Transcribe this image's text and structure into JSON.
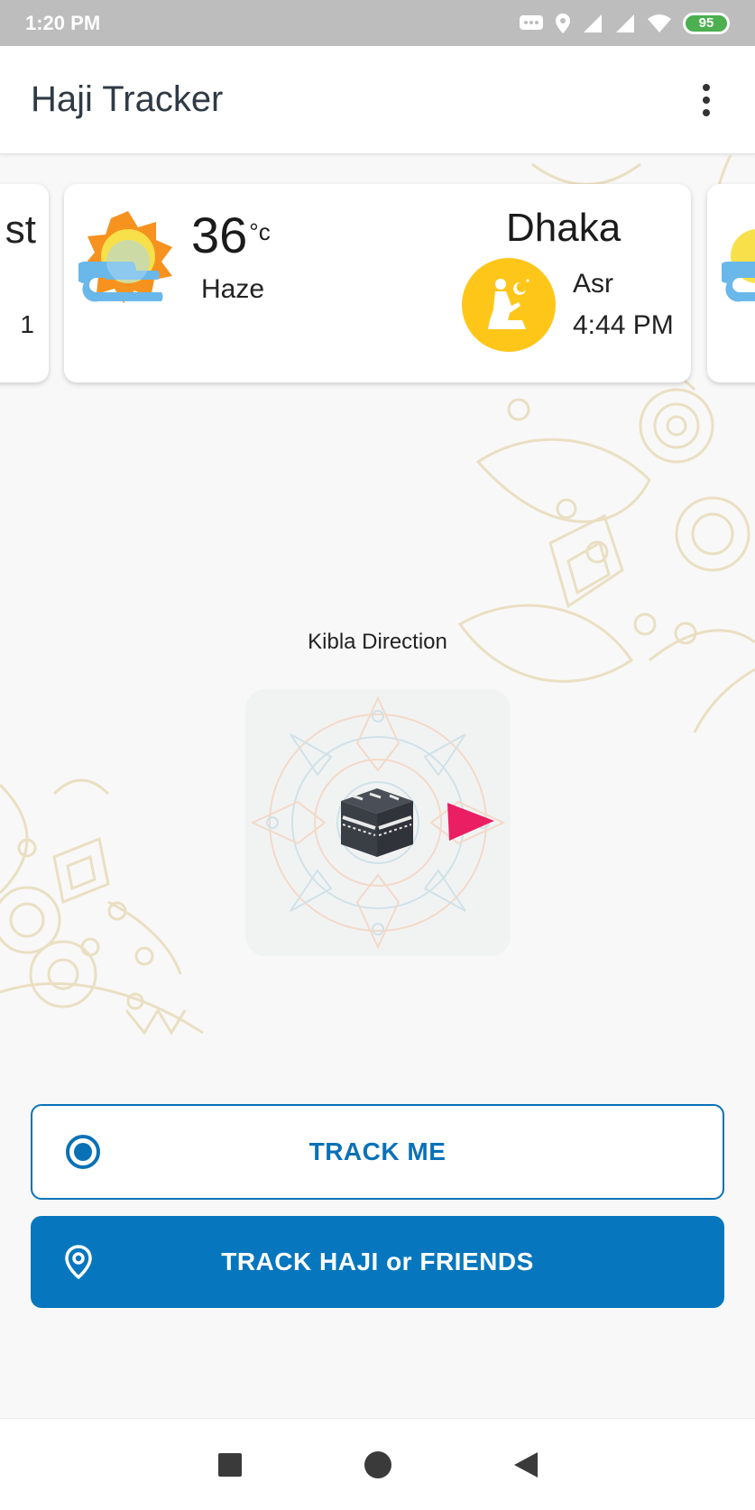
{
  "status_bar": {
    "time": "1:20 PM",
    "battery": "95"
  },
  "app_bar": {
    "title": "Haji Tracker"
  },
  "cards": {
    "left_fragment": {
      "top_text": "st",
      "bottom_text": "1"
    },
    "main": {
      "temperature": "36",
      "temperature_unit": "°c",
      "condition": "Haze",
      "city": "Dhaka",
      "prayer_name": "Asr",
      "prayer_time": "4:44 PM"
    }
  },
  "kibla": {
    "label": "Kibla Direction"
  },
  "buttons": {
    "track_me": "TRACK ME",
    "track_friends": "TRACK HAJI or FRIENDS"
  },
  "icons": {
    "weather": "haze-sun-icon",
    "prayer": "prayer-person-icon",
    "kaaba": "kaaba-icon",
    "direction": "direction-arrow-icon",
    "track_me": "radio-target-icon",
    "track_friends": "location-pin-icon"
  },
  "colors": {
    "primary": "#0677be",
    "prayer_badge": "#ffc61a",
    "direction_arrow": "#e91e63",
    "battery": "#4caf50"
  }
}
